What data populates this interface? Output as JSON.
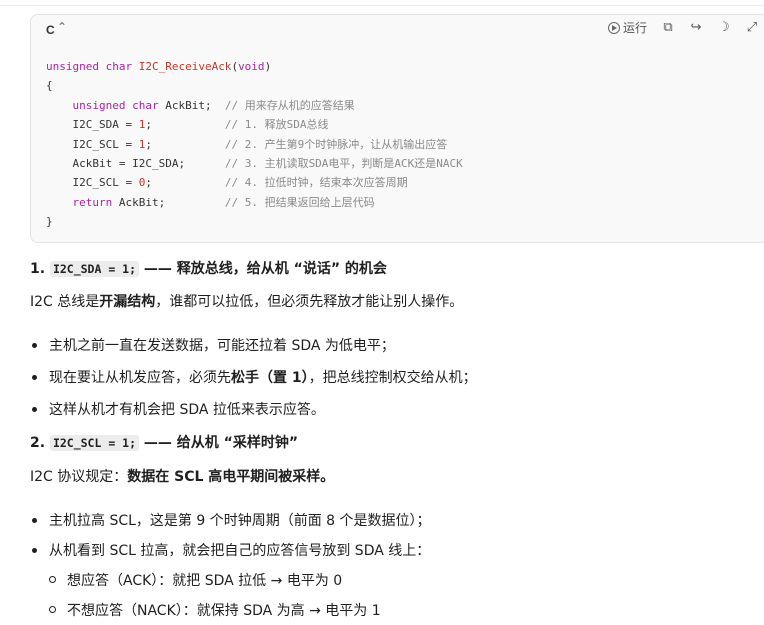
{
  "code_block": {
    "language": "C",
    "run_label": "运行",
    "lines": [
      {
        "kw1": "unsigned char ",
        "fn": "I2C_ReceiveAck",
        "p1": "(",
        "kw2": "void",
        "p2": ")"
      },
      "{",
      {
        "kw": "unsigned char ",
        "code": "AckBit;  ",
        "comment": "// 用来存从机的应答结果"
      },
      {
        "code": "I2C_SDA = ",
        "num": "1",
        "rest": ";           ",
        "comment": "// 1. 释放SDA总线"
      },
      {
        "code": "I2C_SCL = ",
        "num": "1",
        "rest": ";           ",
        "comment": "// 2. 产生第9个时钟脉冲，让从机输出应答"
      },
      {
        "code": "AckBit = I2C_SDA;      ",
        "comment": "// 3. 主机读取SDA电平，判断是ACK还是NACK"
      },
      {
        "code": "I2C_SCL = ",
        "num": "0",
        "rest": ";           ",
        "comment": "// 4. 拉低时钟，结束本次应答周期"
      },
      {
        "kw": "return ",
        "code": "AckBit;         ",
        "comment": "// 5. 把结果返回给上层代码"
      },
      "}"
    ]
  },
  "section1": {
    "num": "1.",
    "code": "I2C_SDA = 1;",
    "title": " —— 释放总线，给从机 “说话” 的机会",
    "para_a": "I2C 总线是",
    "para_b": "开漏结构",
    "para_c": "，谁都可以拉低，但必须先释放才能让别人操作。",
    "bullets": [
      {
        "text": "主机之前一直在发送数据，可能还拉着 SDA 为低电平；"
      },
      {
        "a": "现在要让从机发应答，必须先",
        "b": "松手（置 1）",
        "c": "，把总线控制权交给从机；"
      },
      {
        "text": "这样从机才有机会把 SDA 拉低来表示应答。"
      }
    ]
  },
  "section2": {
    "num": "2.",
    "code": "I2C_SCL = 1;",
    "title": " —— 给从机 “采样时钟”",
    "para_a": "I2C 协议规定：",
    "para_b": "数据在 SCL 高电平期间被采样。",
    "bullets": [
      "主机拉高 SCL，这是第 9 个时钟周期（前面 8 个是数据位）；",
      "从机看到 SCL 拉高，就会把自己的应答信号放到 SDA 线上："
    ],
    "sub_bullets": [
      "想应答（ACK）：就把 SDA 拉低 → 电平为 0",
      "不想应答（NACK）：就保持 SDA 为高 → 电平为 1"
    ]
  }
}
